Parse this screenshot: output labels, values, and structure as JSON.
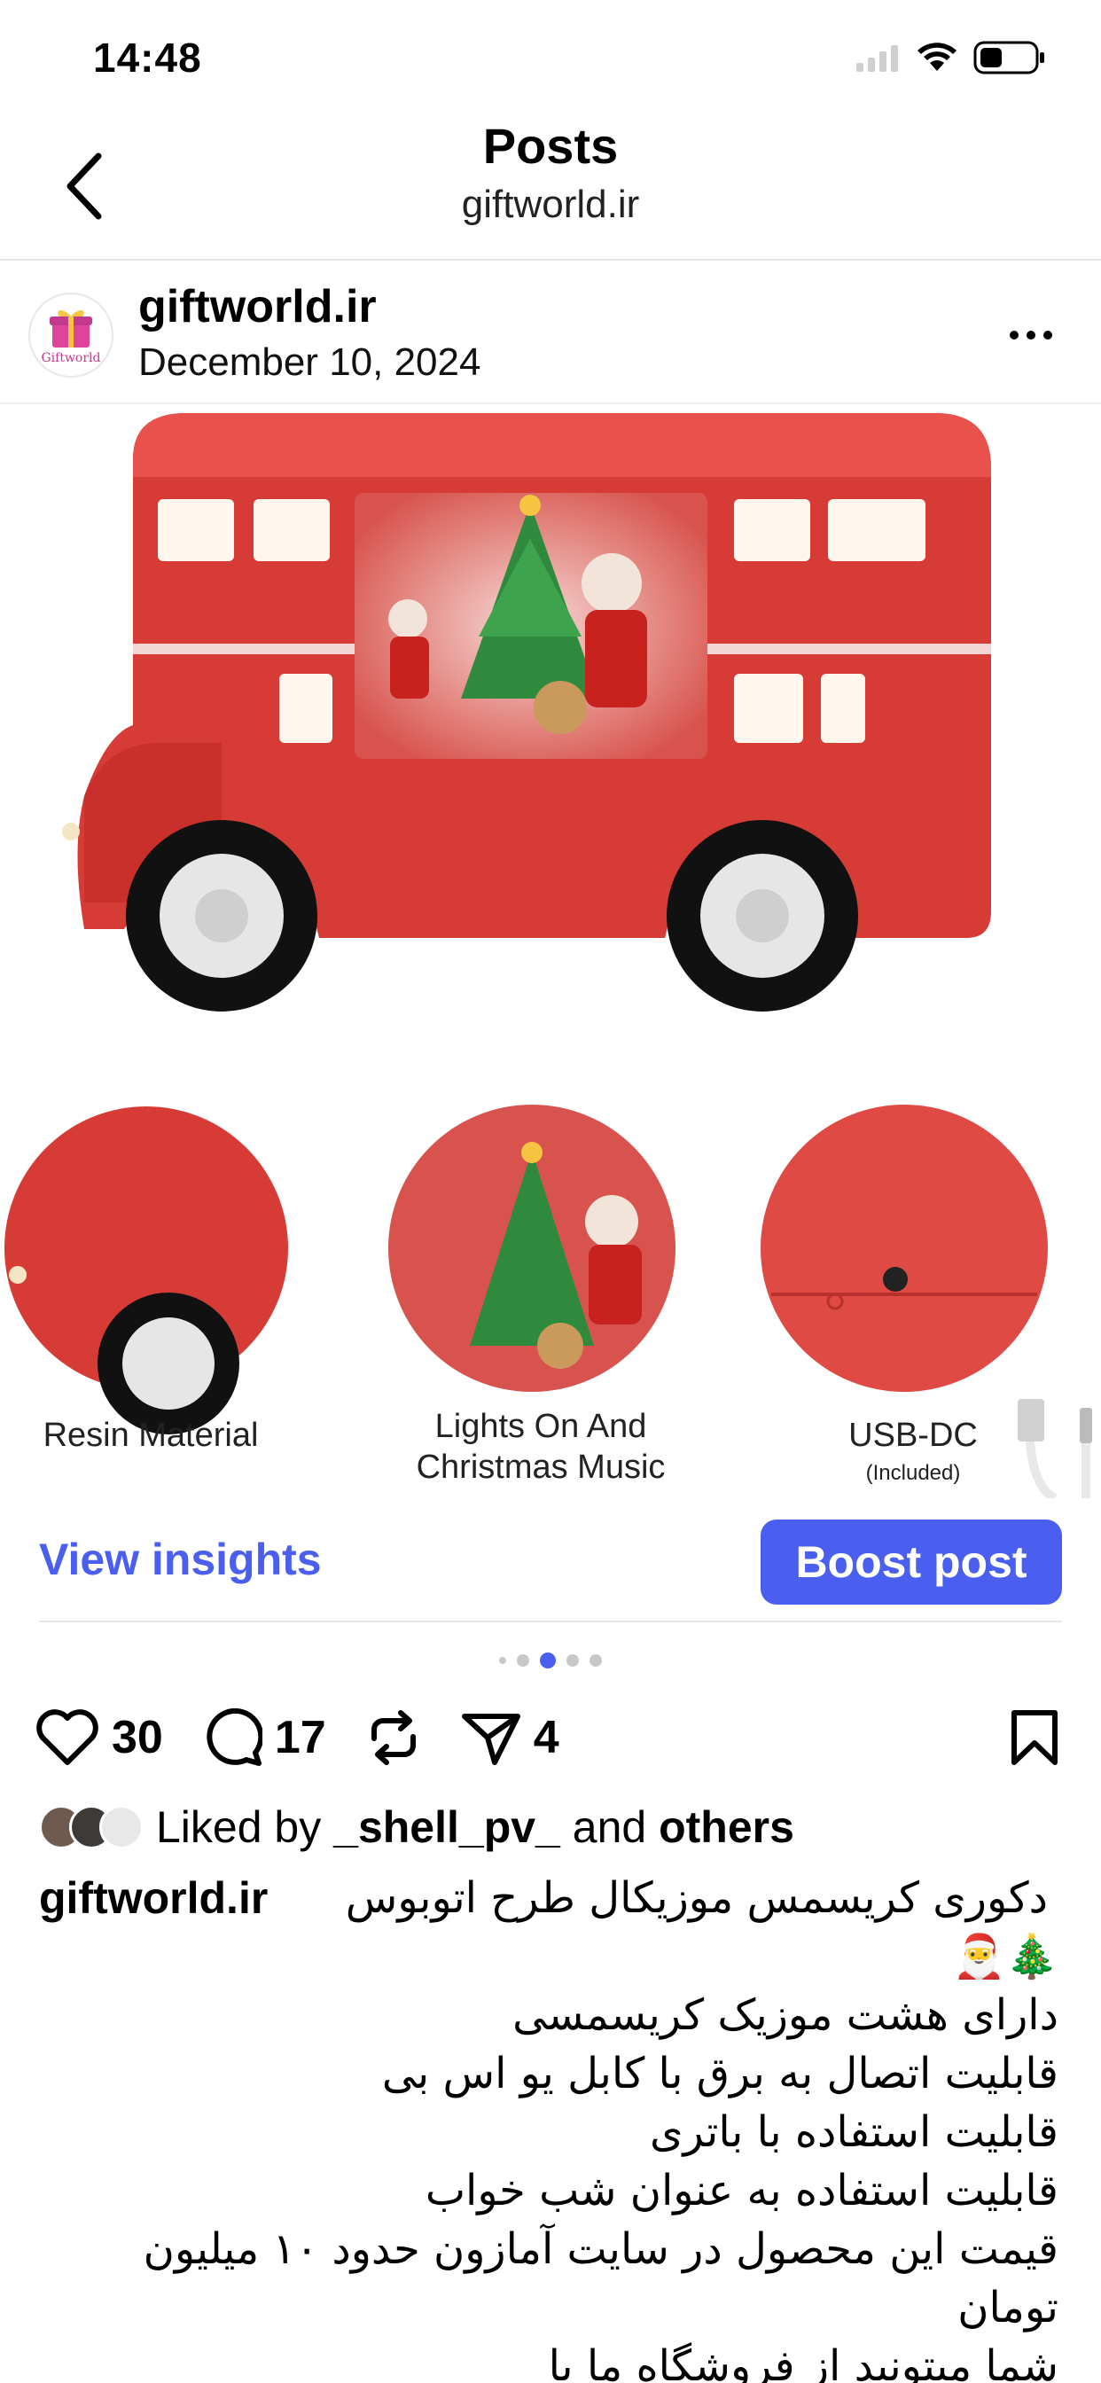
{
  "status_bar": {
    "time": "14:48"
  },
  "nav": {
    "title": "Posts",
    "subtitle": "giftworld.ir"
  },
  "post": {
    "avatar_text": "Giftworld",
    "username": "giftworld.ir",
    "date": "December 10, 2024"
  },
  "image": {
    "features": [
      {
        "label": "Resin Material"
      },
      {
        "label_line1": "Lights On And",
        "label_line2": "Christmas Music"
      },
      {
        "label": "USB-DC",
        "sublabel": "(Included)"
      }
    ]
  },
  "insights": {
    "view_label": "View insights",
    "boost_label": "Boost post"
  },
  "pager": {
    "count": 5,
    "active": 2
  },
  "actions": {
    "likes": "30",
    "comments": "17",
    "shares": "4"
  },
  "liked_by": {
    "prefix": "Liked by",
    "user": "_shell_pv_",
    "and": "and",
    "others": "others"
  },
  "caption": {
    "username": "giftworld.ir",
    "lines": [
      "دکوری کریسمس موزیکال طرح اتوبوس",
      "🎄🎅",
      "دارای هشت موزیک کریسمسی",
      "قابلیت اتصال به برق با کابل یو اس بی",
      "قابلیت استفاده با باتری",
      "قابلیت استفاده به عنوان شب خواب",
      "قیمت این محصول در سایت آمازون حدود ۱۰ میلیون",
      "تومان",
      "شما میتونید از فروشگاه ما با"
    ]
  },
  "colors": {
    "accent": "#4a5ef0",
    "bus_red": "#d63b36"
  }
}
